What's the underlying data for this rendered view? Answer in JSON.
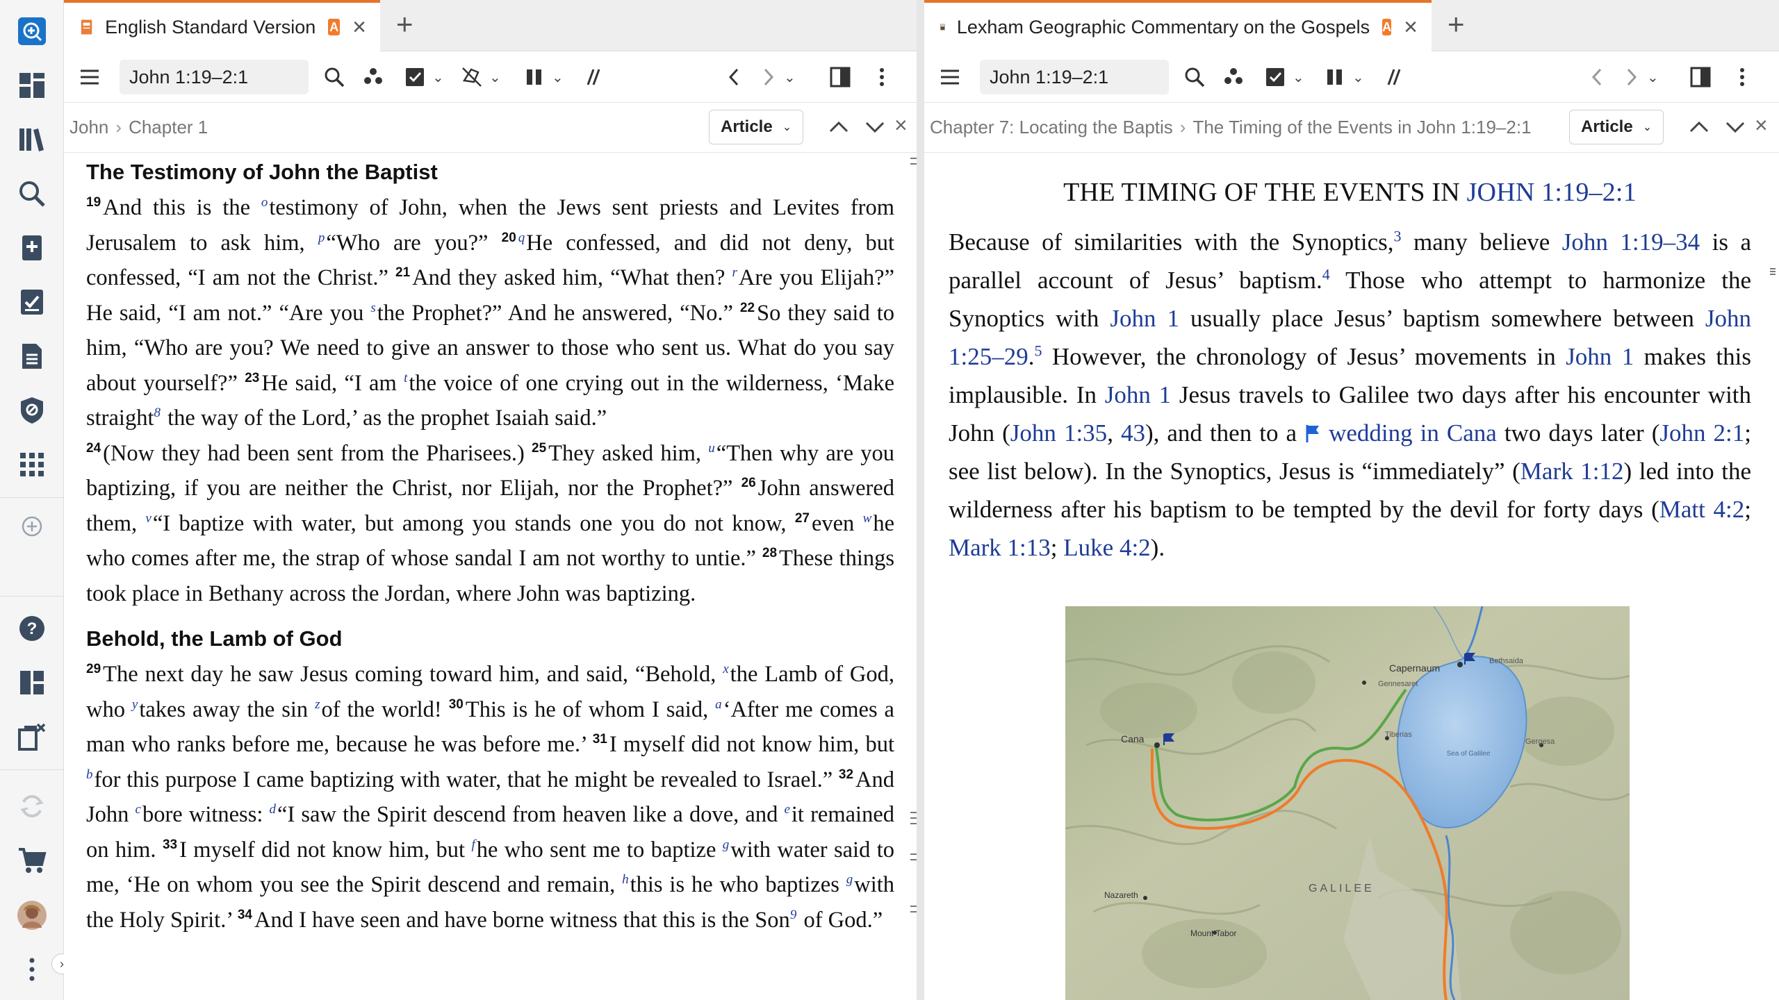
{
  "rail": {
    "items": [
      "search-add-icon",
      "dashboard-icon",
      "library-icon",
      "search-icon",
      "add-doc-icon",
      "checklist-icon",
      "document-icon",
      "shield-icon",
      "apps-icon",
      "add-circle-icon",
      "help-icon",
      "layout-icon",
      "close-layout-icon",
      "sync-icon",
      "cart-icon",
      "avatar",
      "more-icon",
      "expand-icon"
    ]
  },
  "left": {
    "tab": {
      "title": "English Standard Version",
      "badge": "A"
    },
    "reference": "John 1:19–2:1",
    "breadcrumb": [
      "John",
      "Chapter 1"
    ],
    "view_button": "Article",
    "headings": [
      "The Testimony of John the Baptist",
      "Behold, the Lamb of God"
    ]
  },
  "right": {
    "tab": {
      "title": "Lexham Geographic Commentary on the Gospels",
      "badge": "A"
    },
    "reference": "John 1:19–2:1",
    "breadcrumb": [
      "Chapter 7: Locating the Baptis",
      "The Timing of the Events in John 1:19–2:1"
    ],
    "view_button": "Article",
    "title_prefix": "THE TIMING OF THE EVENTS IN ",
    "title_link": "JOHN 1:19–2:1",
    "map_labels": {
      "capernaum": "Capernaum",
      "cana": "Cana",
      "galilee": "GALILEE",
      "nazareth": "Nazareth",
      "tabor": "Mount Tabor",
      "sea": "Sea of Galilee",
      "bethsaida": "Bethsaida",
      "gennesaret": "Gennesaret",
      "tiberias": "Tiberias",
      "gergesa": "Gergesa"
    }
  },
  "colors": {
    "accent": "#f27b2c",
    "link": "#1e3c96"
  }
}
